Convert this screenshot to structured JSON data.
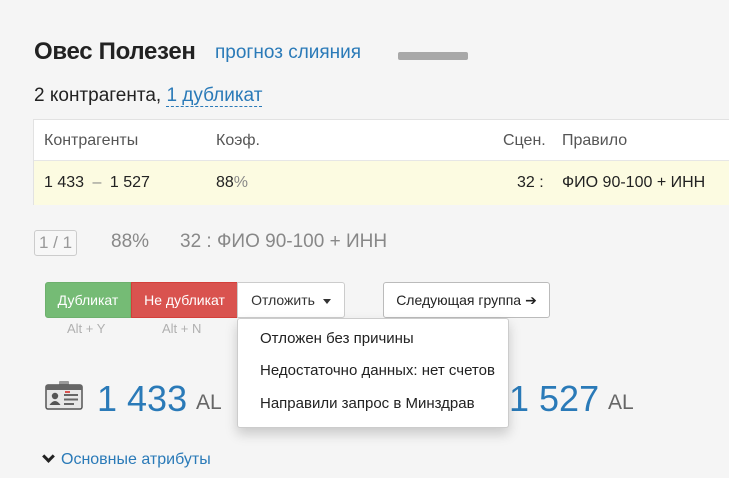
{
  "header": {
    "title": "Овес Полезен",
    "forecast_link": "прогноз слияния",
    "counts_prefix": "2 контрагента, ",
    "duplicates_link": "1 дубликат"
  },
  "table": {
    "columns": [
      "Контрагенты",
      "Коэф.",
      "Сцен.",
      "Правило"
    ],
    "row": {
      "left_id": "1 433",
      "separator": "–",
      "right_id": "1 527",
      "coef_value": "88",
      "coef_unit": "%",
      "scenario": "32 :",
      "rule": "ФИО 90-100 + ИНН"
    }
  },
  "summary": {
    "counter": "1 / 1",
    "percent": "88%",
    "rule": "32 : ФИО 90-100 + ИНН"
  },
  "actions": {
    "duplicate": "Дубликат",
    "not_duplicate": "Не дубликат",
    "postpone": "Отложить",
    "next_group": "Следующая группа",
    "hint_duplicate": "Alt + Y",
    "hint_not_duplicate": "Alt + N"
  },
  "dropdown": {
    "items": [
      "Отложен без причины",
      "Недостаточно данных: нет счетов",
      "Направили запрос в Минздрав"
    ]
  },
  "records": {
    "left_number": "1 433",
    "left_unit": "AL",
    "right_number": "1 527",
    "right_unit": "AL"
  },
  "attributes_link": "Основные атрибуты",
  "icons": {
    "card": "id-card-icon",
    "next": "arrow-right-icon",
    "expand": "chevron-down-icon",
    "menu": "caret-down-icon"
  },
  "colors": {
    "link": "#2a7ab8",
    "success": "#75bb75",
    "danger": "#d9534f",
    "highlight_row": "#fcfbe1"
  }
}
